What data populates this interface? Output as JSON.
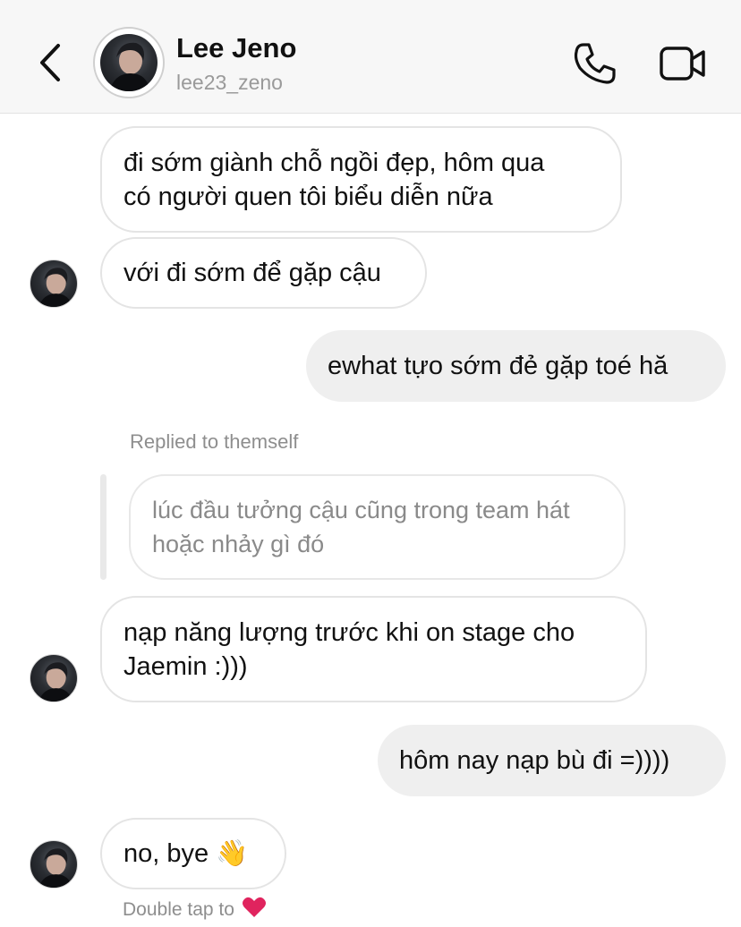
{
  "header": {
    "contact_name": "Lee Jeno",
    "contact_handle": "lee23_zeno",
    "icons": {
      "back": "chevron-left-icon",
      "call": "phone-icon",
      "video": "video-camera-icon"
    }
  },
  "messages": [
    {
      "direction": "in",
      "text": "đi sớm giành chỗ ngồi đẹp, hôm qua\ncó người quen tôi biểu diễn nữa",
      "avatar": false
    },
    {
      "direction": "in",
      "text": "với đi sớm để gặp cậu",
      "avatar": true
    },
    {
      "direction": "out",
      "text": "ewhat tựo sớm đẻ gặp toé hă"
    },
    {
      "direction": "in",
      "text": "nạp năng lượng trước khi on stage cho\nJaemin :)))",
      "avatar": true
    },
    {
      "direction": "out",
      "text": "hôm nay nạp bù đi =))))"
    },
    {
      "direction": "in",
      "text": "no, bye 👋",
      "avatar": true
    }
  ],
  "reply": {
    "label": "Replied to themself",
    "quoted_text": "lúc đầu tưởng cậu cũng trong team hát\nhoặc nhảy gì đó"
  },
  "footer_hint": {
    "text": "Double tap to",
    "emoji": "❤️"
  },
  "colors": {
    "header_bg": "#f7f7f7",
    "outgoing_bubble": "#efefef",
    "incoming_border": "#e4e4e4",
    "secondary_text": "#8e8e8e",
    "heart": "#e0245e"
  }
}
